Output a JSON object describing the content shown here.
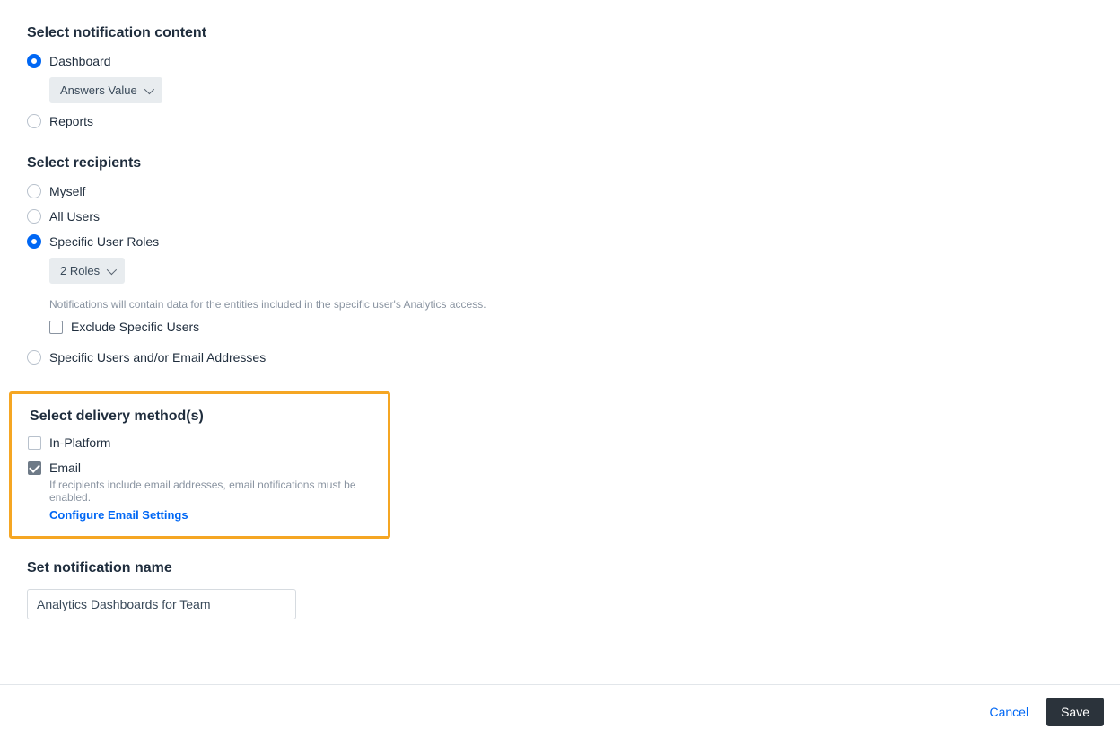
{
  "notification_content": {
    "title": "Select notification content",
    "options": {
      "dashboard": "Dashboard",
      "reports": "Reports"
    },
    "dashboard_select_label": "Answers Value"
  },
  "recipients": {
    "title": "Select recipients",
    "options": {
      "myself": "Myself",
      "all_users": "All Users",
      "specific_roles": "Specific User Roles",
      "specific_users_emails": "Specific Users and/or Email Addresses"
    },
    "roles_select_label": "2 Roles",
    "roles_helper": "Notifications will contain data for the entities included in the specific user's Analytics access.",
    "exclude_label": "Exclude Specific Users"
  },
  "delivery": {
    "title": "Select delivery method(s)",
    "in_platform": "In-Platform",
    "email": "Email",
    "email_helper": "If recipients include email addresses, email notifications must be enabled.",
    "configure_link": "Configure Email Settings"
  },
  "name_section": {
    "title": "Set notification name",
    "value": "Analytics Dashboards for Team"
  },
  "footer": {
    "cancel": "Cancel",
    "save": "Save"
  }
}
